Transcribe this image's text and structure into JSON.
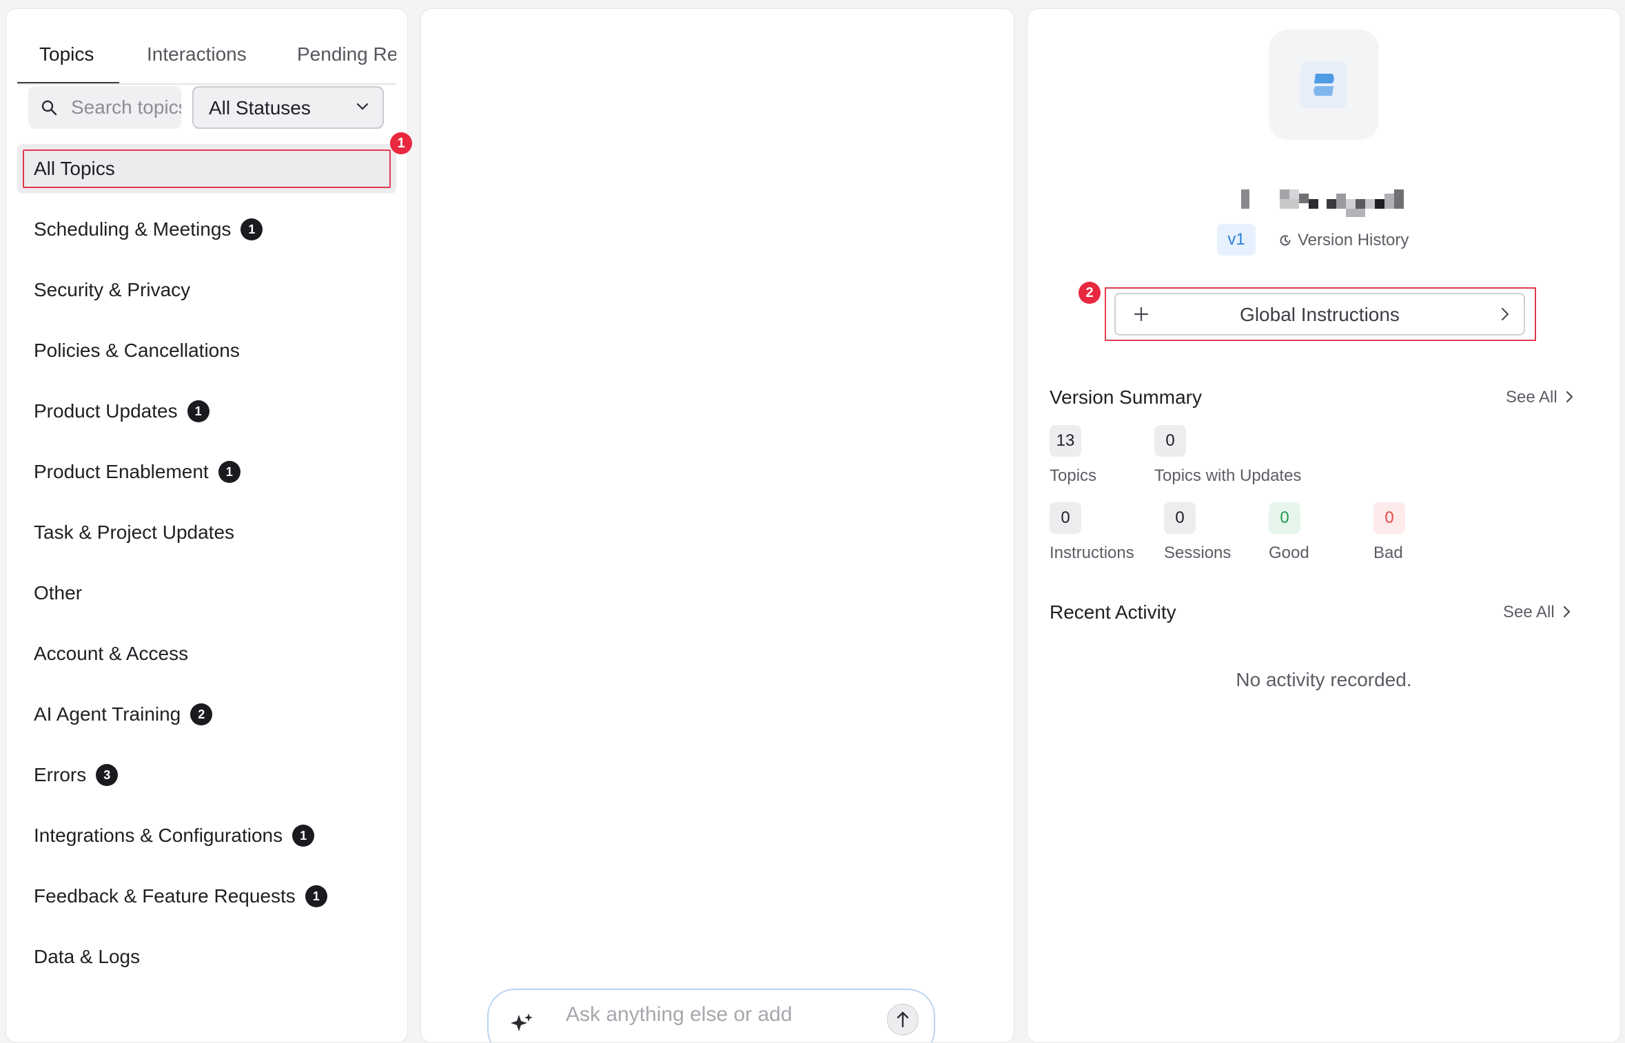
{
  "tabs": [
    {
      "label": "Topics"
    },
    {
      "label": "Interactions"
    },
    {
      "label": "Pending Rev"
    }
  ],
  "search": {
    "placeholder": "Search topics"
  },
  "filter": {
    "selected": "All Statuses"
  },
  "topics": [
    {
      "label": "All Topics",
      "count": ""
    },
    {
      "label": "Scheduling & Meetings",
      "count": "1"
    },
    {
      "label": "Security & Privacy",
      "count": ""
    },
    {
      "label": "Policies & Cancellations",
      "count": ""
    },
    {
      "label": "Product Updates",
      "count": "1"
    },
    {
      "label": "Product Enablement",
      "count": "1"
    },
    {
      "label": "Task & Project Updates",
      "count": ""
    },
    {
      "label": "Other",
      "count": ""
    },
    {
      "label": "Account & Access",
      "count": ""
    },
    {
      "label": "AI Agent Training",
      "count": "2"
    },
    {
      "label": "Errors",
      "count": "3"
    },
    {
      "label": "Integrations & Configurations",
      "count": "1"
    },
    {
      "label": "Feedback & Feature Requests",
      "count": "1"
    },
    {
      "label": "Data & Logs",
      "count": ""
    }
  ],
  "annotations": {
    "marker_1": "1",
    "marker_2": "2"
  },
  "composer": {
    "placeholder": "Ask anything else or add"
  },
  "agent": {
    "version": "v1",
    "version_history_label": "Version History"
  },
  "global_instructions": {
    "label": "Global Instructions"
  },
  "version_summary": {
    "title": "Version Summary",
    "see_all": "See All",
    "stats": {
      "topics": {
        "value": "13",
        "label": "Topics"
      },
      "topics_with_updates": {
        "value": "0",
        "label": "Topics with Updates"
      },
      "instructions": {
        "value": "0",
        "label": "Instructions"
      },
      "sessions": {
        "value": "0",
        "label": "Sessions"
      },
      "good": {
        "value": "0",
        "label": "Good"
      },
      "bad": {
        "value": "0",
        "label": "Bad"
      }
    }
  },
  "recent_activity": {
    "title": "Recent Activity",
    "see_all": "See All",
    "empty": "No activity recorded."
  },
  "colors": {
    "highlight": "#e03a4e",
    "accent_blue": "#2f7fd8",
    "good": "#1f9a4b",
    "bad": "#e14b4b"
  }
}
